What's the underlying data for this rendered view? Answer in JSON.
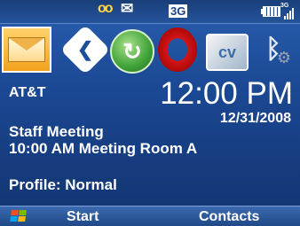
{
  "status_bar": {
    "icons": [
      "voicemail-icon",
      "new-message-icon",
      "3g-icon",
      "battery-icon",
      "3g-signal-icon"
    ],
    "network_label": "3G",
    "signal_network_label": "3G"
  },
  "app_strip": {
    "icons": [
      "messaging-icon",
      "navigation-icon",
      "sync-icon",
      "opera-browser-icon",
      "cellular-video-icon",
      "bluetooth-settings-icon"
    ],
    "video_label": "cv"
  },
  "home": {
    "carrier": "AT&T",
    "time": "12:00 PM",
    "date": "12/31/2008",
    "appointment_title": "Staff Meeting",
    "appointment_detail": "10:00 AM Meeting Room A",
    "profile": "Profile: Normal"
  },
  "softkeys": {
    "left": "Start",
    "right": "Contacts"
  },
  "colors": {
    "background": "#1c4a96",
    "softkey_bar": "#2a5aa0",
    "text": "#ffffff",
    "voicemail": "#ffd54a"
  }
}
